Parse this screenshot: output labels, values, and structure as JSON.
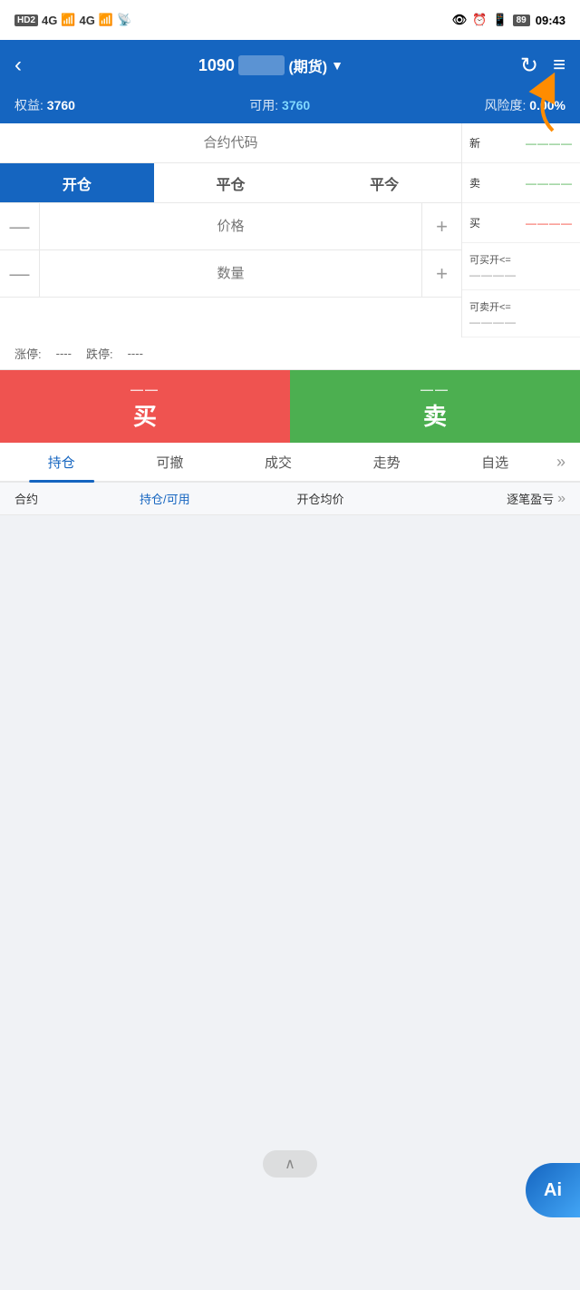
{
  "statusBar": {
    "hd2": "HD2",
    "network": "4G",
    "time": "09:43",
    "batteryLevel": "89"
  },
  "topNav": {
    "backIcon": "‹",
    "accountNumber": "1090",
    "accountSuffix": "(期货)",
    "dropdownIcon": "▼",
    "refreshIcon": "↻",
    "menuIcon": "≡"
  },
  "accountBar": {
    "equityLabel": "权益:",
    "equityValue": "3760",
    "availableLabel": "可用:",
    "availableValue": "3760",
    "riskLabel": "风险度:",
    "riskValue": "0.00%"
  },
  "rightPanel": {
    "newLabel": "新",
    "newValue": "————",
    "sellLabel": "卖",
    "sellValue": "————",
    "buyLabel": "买",
    "buyValue": "————",
    "limitBuyLabel": "可买开<=",
    "limitBuyValue": "————",
    "limitSellLabel": "可卖开<=",
    "limitSellValue": "————"
  },
  "contractInput": {
    "placeholder": "合约代码"
  },
  "tradeTabs": [
    {
      "label": "开仓",
      "active": true
    },
    {
      "label": "平仓",
      "active": false
    },
    {
      "label": "平今",
      "active": false
    }
  ],
  "priceInput": {
    "minusIcon": "—",
    "placeholder": "价格",
    "plusIcon": "+"
  },
  "quantityInput": {
    "minusIcon": "—",
    "placeholder": "数量",
    "plusIcon": "+"
  },
  "limitInfo": {
    "riseLimitLabel": "涨停:",
    "riseLimitValue": "----",
    "fallLimitLabel": "跌停:",
    "fallLimitValue": "----"
  },
  "actionButtons": {
    "buyDashes": "——",
    "buyLabel": "买",
    "sellDashes": "——",
    "sellLabel": "卖"
  },
  "bottomTabs": [
    {
      "label": "持仓",
      "active": true
    },
    {
      "label": "可撤",
      "active": false
    },
    {
      "label": "成交",
      "active": false
    },
    {
      "label": "走势",
      "active": false
    },
    {
      "label": "自选",
      "active": false
    }
  ],
  "tableHeader": {
    "contractLabel": "合约",
    "holdingLabel": "持仓/可用",
    "avgPriceLabel": "开仓均价",
    "pnlLabel": "逐笔盈亏",
    "moreIcon": "»"
  },
  "ai": {
    "label": "Ai"
  },
  "bottomArrow": "∧"
}
